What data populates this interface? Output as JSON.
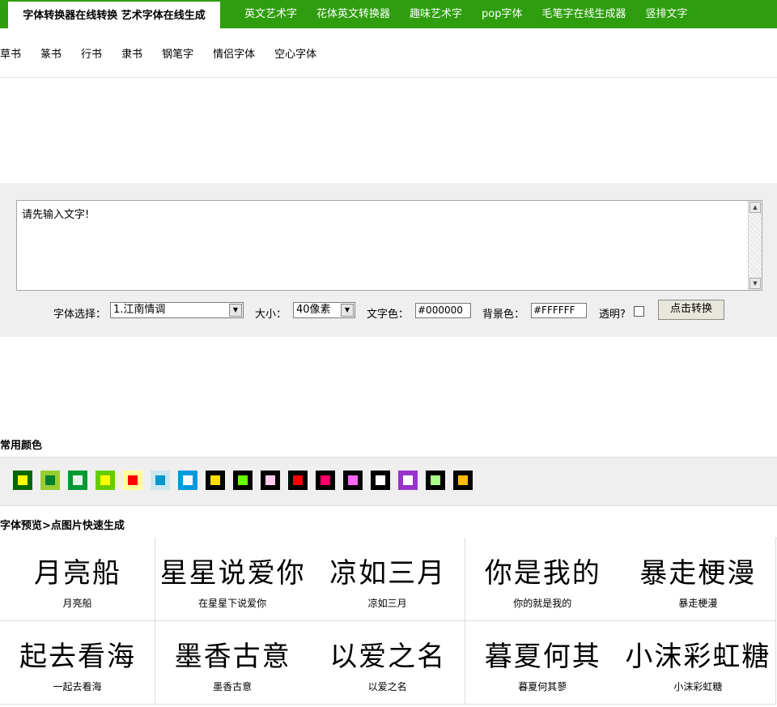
{
  "header": {
    "brand": "字体转换器在线转换 艺术字体在线生成",
    "nav": [
      "英文艺术字",
      "花体英文转换器",
      "趣味艺术字",
      "pop字体",
      "毛笔字在线生成器",
      "竖排文字"
    ]
  },
  "subnav": [
    "草书",
    "篆书",
    "行书",
    "隶书",
    "钢笔字",
    "情侣字体",
    "空心字体"
  ],
  "editor": {
    "text": "请先输入文字!",
    "font_label": "字体选择：",
    "font_value": "1.江南情调",
    "size_label": "大小：",
    "size_value": "40像素",
    "color_label": "文字色：",
    "color_value": "#000000",
    "bg_label": "背景色：",
    "bg_value": "#FFFFFF",
    "transparent_label": "透明?",
    "convert_label": "点击转换"
  },
  "colors_title": "常用颜色",
  "colors": [
    {
      "border": "#006600",
      "fill": "#ffff00"
    },
    {
      "border": "#99cc33",
      "fill": "#00802b"
    },
    {
      "border": "#009933",
      "fill": "#e6f2e6"
    },
    {
      "border": "#66cc00",
      "fill": "#ffff00"
    },
    {
      "border": "#ffff99",
      "fill": "#ff0000"
    },
    {
      "border": "#cce6ee",
      "fill": "#0099cc"
    },
    {
      "border": "#0099dd",
      "fill": "#ffffff"
    },
    {
      "border": "#000000",
      "fill": "#ffdd00"
    },
    {
      "border": "#000000",
      "fill": "#66ff00"
    },
    {
      "border": "#000000",
      "fill": "#ffccee"
    },
    {
      "border": "#000000",
      "fill": "#ff0000"
    },
    {
      "border": "#000000",
      "fill": "#ff0066"
    },
    {
      "border": "#000000",
      "fill": "#ff66ff"
    },
    {
      "border": "#000000",
      "fill": "#ffffff"
    },
    {
      "border": "#9933cc",
      "fill": "#ffffff"
    },
    {
      "border": "#000000",
      "fill": "#aaff88"
    },
    {
      "border": "#000000",
      "fill": "#ffbb00"
    }
  ],
  "preview_title": "字体预览>点图片快速生成",
  "previews": [
    {
      "art": "月亮船",
      "caption": "月亮船"
    },
    {
      "art": "星星说爱你",
      "caption": "在星星下说爱你"
    },
    {
      "art": "凉如三月",
      "caption": "凉如三月"
    },
    {
      "art": "你是我的",
      "caption": "你的就是我的"
    },
    {
      "art": "暴走梗漫",
      "caption": "暴走梗漫"
    },
    {
      "art": "起去看海",
      "caption": "一起去看海"
    },
    {
      "art": "墨香古意",
      "caption": "墨香古意"
    },
    {
      "art": "以爱之名",
      "caption": "以爱之名"
    },
    {
      "art": "暮夏何其",
      "caption": "暮夏何其蓼"
    },
    {
      "art": "小沫彩虹糖",
      "caption": "小沫彩虹糖"
    }
  ]
}
